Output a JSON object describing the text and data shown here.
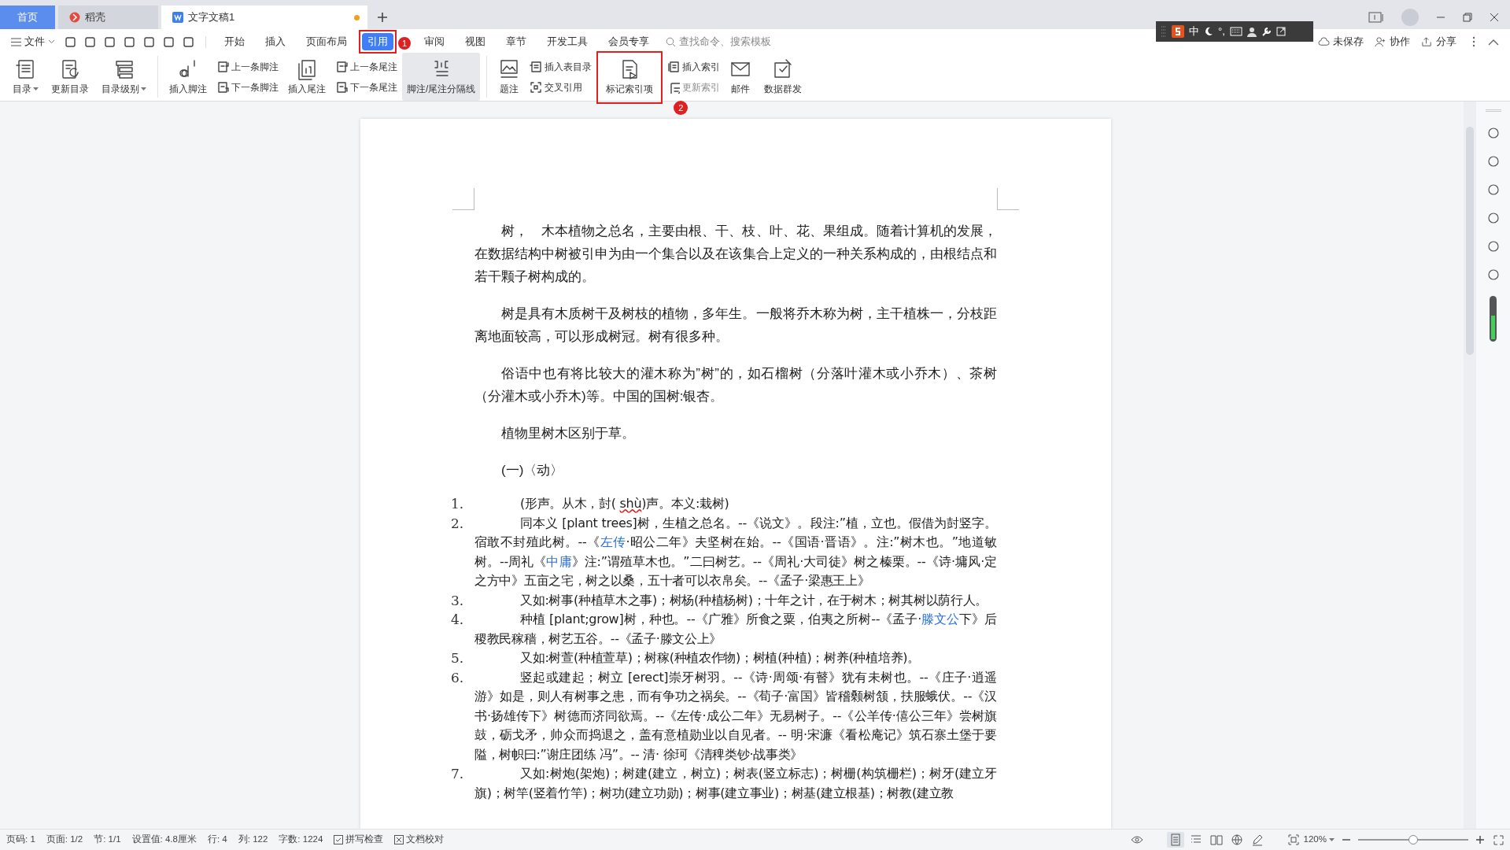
{
  "title_tabs": [
    {
      "label": "首页",
      "kind": "home",
      "selected": false,
      "unsaved": false
    },
    {
      "label": "稻壳",
      "kind": "app",
      "selected": false,
      "unsaved": false
    },
    {
      "label": "文字文稿1",
      "kind": "doc",
      "selected": true,
      "unsaved": true
    }
  ],
  "menu": {
    "file": "文件",
    "tabs": [
      {
        "label": "开始",
        "selected": false
      },
      {
        "label": "插入",
        "selected": false
      },
      {
        "label": "页面布局",
        "selected": false
      },
      {
        "label": "引用",
        "selected": true,
        "annotation": "1"
      },
      {
        "label": "审阅",
        "selected": false
      },
      {
        "label": "视图",
        "selected": false
      },
      {
        "label": "章节",
        "selected": false
      },
      {
        "label": "开发工具",
        "selected": false
      },
      {
        "label": "会员专享",
        "selected": false
      }
    ],
    "search": {
      "placeholder": "查找命令、搜索模板"
    }
  },
  "ime_toolbar": {
    "mode": "中",
    "punct": "°,"
  },
  "account": [
    {
      "label": "未保存",
      "kind": "cloud"
    },
    {
      "label": "协作",
      "kind": "user"
    },
    {
      "label": "分享",
      "kind": "share"
    }
  ],
  "ribbon": [
    {
      "kind": "large",
      "label": "目录",
      "dropdown": true
    },
    {
      "kind": "large",
      "label": "更新目录",
      "dropdown": false
    },
    {
      "kind": "large",
      "label": "目录级别",
      "dropdown": true
    },
    {
      "kind": "sep"
    },
    {
      "kind": "large",
      "label": "插入脚注",
      "dropdown": false
    },
    {
      "kind": "stack",
      "items": [
        {
          "label": "上一条脚注",
          "disabled": false
        },
        {
          "label": "下一条脚注",
          "disabled": false
        }
      ]
    },
    {
      "kind": "large",
      "label": "插入尾注",
      "dropdown": false
    },
    {
      "kind": "stack",
      "items": [
        {
          "label": "上一条尾注",
          "disabled": false
        },
        {
          "label": "下一条尾注",
          "disabled": false
        }
      ]
    },
    {
      "kind": "large",
      "label": "脚注/尾注分隔线",
      "dropdown": false,
      "highlighted": true
    },
    {
      "kind": "sep"
    },
    {
      "kind": "large",
      "label": "题注",
      "dropdown": false
    },
    {
      "kind": "stack",
      "items": [
        {
          "label": "插入表目录",
          "disabled": false
        },
        {
          "label": "交叉引用",
          "disabled": false
        }
      ]
    },
    {
      "kind": "large",
      "label": "标记索引项",
      "dropdown": false,
      "annotation": "2"
    },
    {
      "kind": "stack",
      "items": [
        {
          "label": "插入索引",
          "disabled": false
        },
        {
          "label": "更新索引",
          "disabled": true
        }
      ]
    },
    {
      "kind": "large",
      "label": "邮件",
      "dropdown": false
    },
    {
      "kind": "large",
      "label": "数据群发",
      "dropdown": false
    }
  ],
  "document": [
    {
      "kind": "para",
      "segments": [
        {
          "text": "树，　木本植物之总名，主要由根、干、枝、叶、花、果组成。随着计算机的发展，在数据结构中树被引申为由一个集合以及在该集合上定义的一种关系构成的，由根结点和若干颗子树构成的。"
        }
      ]
    },
    {
      "kind": "para",
      "segments": [
        {
          "text": "树是具有木质树干及树枝的植物，多年生。一般将乔木称为树，主干植株一，分枝距离地面较高，可以形成树冠。树有很多种。"
        }
      ]
    },
    {
      "kind": "para",
      "segments": [
        {
          "text": "俗语中也有将比较大的灌木称为”树”的，如石榴树（分落叶灌木或小乔木）、茶树（分灌木或小乔木)等。中国的国树:银杏。"
        }
      ]
    },
    {
      "kind": "para",
      "segments": [
        {
          "text": "植物里树木区别于草。"
        }
      ]
    },
    {
      "kind": "para",
      "segments": [
        {
          "text": "(一)〈动〉"
        }
      ]
    },
    {
      "kind": "item",
      "number": "1.",
      "segments": [
        {
          "text": "(形声。从木，尌( "
        },
        {
          "text": "shù",
          "spell_error": true
        },
        {
          "text": ")声。本义:栽树)"
        }
      ]
    },
    {
      "kind": "item",
      "number": "2.",
      "segments": [
        {
          "text": "同本义 [plant trees]树，生植之总名。--《说文》。段注:”植，立也。假借为尌竖字。宿敢不封殖此树。--《"
        },
        {
          "text": "左传",
          "link": true
        },
        {
          "text": "·昭公二年》夫坚树在始。--《国语·晋语》。注:”树木也。”地道敏树。--周礼《"
        },
        {
          "text": "中庸",
          "link": true
        },
        {
          "text": "》注:”谓殖草木也。”二曰树艺。--《周礼·大司徒》树之榛栗。--《诗·墉风·定之方中》五亩之宅，树之以桑，五十者可以衣帛矣。--《孟子·梁惠王上》"
        }
      ]
    },
    {
      "kind": "item",
      "number": "3.",
      "segments": [
        {
          "text": "又如:树事(种植草木之事)；树杨(种植杨树)；十年之计，在于树木；树其树以荫行人。"
        }
      ]
    },
    {
      "kind": "item",
      "number": "4.",
      "segments": [
        {
          "text": "种植 [plant;grow]树，种也。--《广雅》所食之粟，伯夷之所树--《孟子·"
        },
        {
          "text": "滕文公",
          "link": true
        },
        {
          "text": "下》后稷教民稼穑，树艺五谷。--《孟子·滕文公上》"
        }
      ]
    },
    {
      "kind": "item",
      "number": "5.",
      "segments": [
        {
          "text": "又如:树萱(种植萱草)；树稼(种植农作物)；树植(种植)；树养(种植培养)。"
        }
      ]
    },
    {
      "kind": "item",
      "number": "6.",
      "segments": [
        {
          "text": "竖起或建起；树立 [erect]崇牙树羽。--《诗·周颂·有瞽》犹有未树也。--《庄子·逍遥游》如是，则人有树事之患，而有争功之祸矣。--《荀子·富国》皆稽颡树颔，扶服蛾伏。--《汉书·扬雄传下》树德而济同欲焉。--《左传·成公二年》无易树子。--《公羊传·僖公三年》尝树旗鼓，砺戈矛，帅众而捣退之，盖有意植勋业以自见者。-- 明·宋濂《看松庵记》筑石寨土堡于要隘，树帜曰:”谢庄团练 冯”。-- 清· 徐珂《清稗类钞·战事类》"
        }
      ]
    },
    {
      "kind": "item",
      "number": "7.",
      "segments": [
        {
          "text": "又如:树炮(架炮)；树建(建立，树立)；树表(竖立标志)；树栅(构筑栅栏)；树牙(建立牙旗)；树竿(竖着竹竿)；树功(建立功勋)；树事(建立事业)；树基(建立根基)；树教(建立教"
        }
      ]
    }
  ],
  "status_bar": {
    "left": [
      {
        "label": "页码: 1",
        "kind": "text"
      },
      {
        "label": "页面: 1/2",
        "kind": "text"
      },
      {
        "label": "节: 1/1",
        "kind": "text"
      },
      {
        "label": "设置值: 4.8厘米",
        "kind": "text"
      },
      {
        "label": "行: 4",
        "kind": "text"
      },
      {
        "label": "列: 122",
        "kind": "text"
      },
      {
        "label": "字数: 1224",
        "kind": "text"
      },
      {
        "label": "拼写检查",
        "kind": "check"
      },
      {
        "label": "文档校对",
        "kind": "proof"
      }
    ],
    "views": [
      {
        "kind": "page",
        "selected": true
      },
      {
        "kind": "outline",
        "selected": false
      },
      {
        "kind": "read",
        "selected": false
      },
      {
        "kind": "web",
        "selected": false
      },
      {
        "kind": "write",
        "selected": false
      }
    ],
    "zoom": "120%",
    "zoom_slider": {
      "level": 0.5
    }
  }
}
